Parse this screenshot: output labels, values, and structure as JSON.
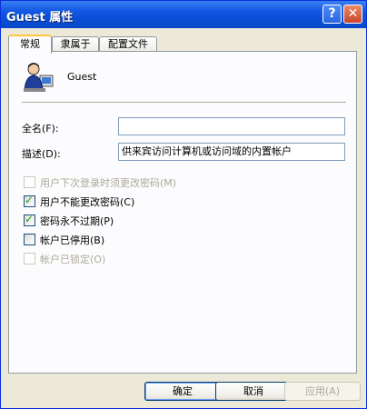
{
  "window": {
    "title": "Guest 属性"
  },
  "title_buttons": {
    "help": "?",
    "close": "✕"
  },
  "tabs": [
    {
      "label": "常规",
      "active": true
    },
    {
      "label": "隶属于",
      "active": false
    },
    {
      "label": "配置文件",
      "active": false
    }
  ],
  "user": {
    "name": "Guest",
    "icon": "user-avatar-icon"
  },
  "form": {
    "fullname_label": "全名(F):",
    "fullname_value": "",
    "description_label": "描述(D):",
    "description_value": "供来宾访问计算机或访问域的内置帐户"
  },
  "checkboxes": [
    {
      "label": "用户下次登录时须更改密码(M)",
      "checked": false,
      "enabled": false
    },
    {
      "label": "用户不能更改密码(C)",
      "checked": true,
      "enabled": true
    },
    {
      "label": "密码永不过期(P)",
      "checked": true,
      "enabled": true
    },
    {
      "label": "帐户已停用(B)",
      "checked": false,
      "enabled": true
    },
    {
      "label": "帐户已锁定(O)",
      "checked": false,
      "enabled": false
    }
  ],
  "buttons": {
    "ok": "确定",
    "cancel": "取消",
    "apply": "应用(A)"
  },
  "colors": {
    "titlebar": "#0a4fd6",
    "checkmark": "#21a121",
    "tab_highlight": "#ffc83c"
  }
}
